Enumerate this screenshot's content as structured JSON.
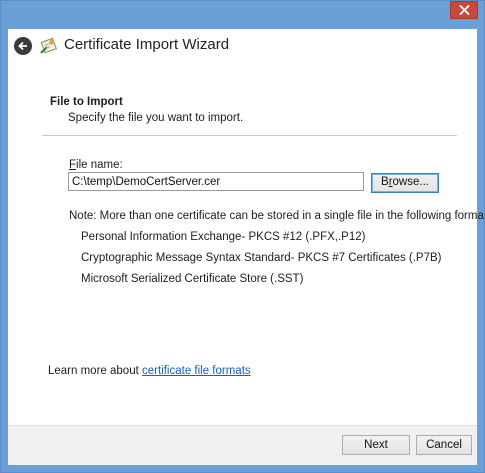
{
  "window": {
    "title": "Certificate Import Wizard",
    "icons": {
      "back": "back-arrow-icon",
      "wizard": "certificate-wizard-icon",
      "close": "close-icon"
    },
    "colors": {
      "frame": "#6b9fd8",
      "close": "#c7493e",
      "link": "#1a5fb4"
    }
  },
  "page": {
    "section_title": "File to Import",
    "section_subtitle": "Specify the file you want to import.",
    "file_name": {
      "label_accesskey": "F",
      "label_rest": "ile name:",
      "value": "C:\\temp\\DemoCertServer.cer"
    },
    "browse_button": {
      "accesskey": "r",
      "before": "B",
      "after": "owse..."
    },
    "note": "Note:  More than one certificate can be stored in a single file in the following formats:",
    "formats": [
      "Personal Information Exchange- PKCS #12 (.PFX,.P12)",
      "Cryptographic Message Syntax Standard- PKCS #7 Certificates (.P7B)",
      "Microsoft Serialized Certificate Store (.SST)"
    ],
    "learn_more_prefix": "Learn more about",
    "learn_more_link": "certificate file formats"
  },
  "footer": {
    "next_label": "Next",
    "cancel_label": "Cancel"
  }
}
